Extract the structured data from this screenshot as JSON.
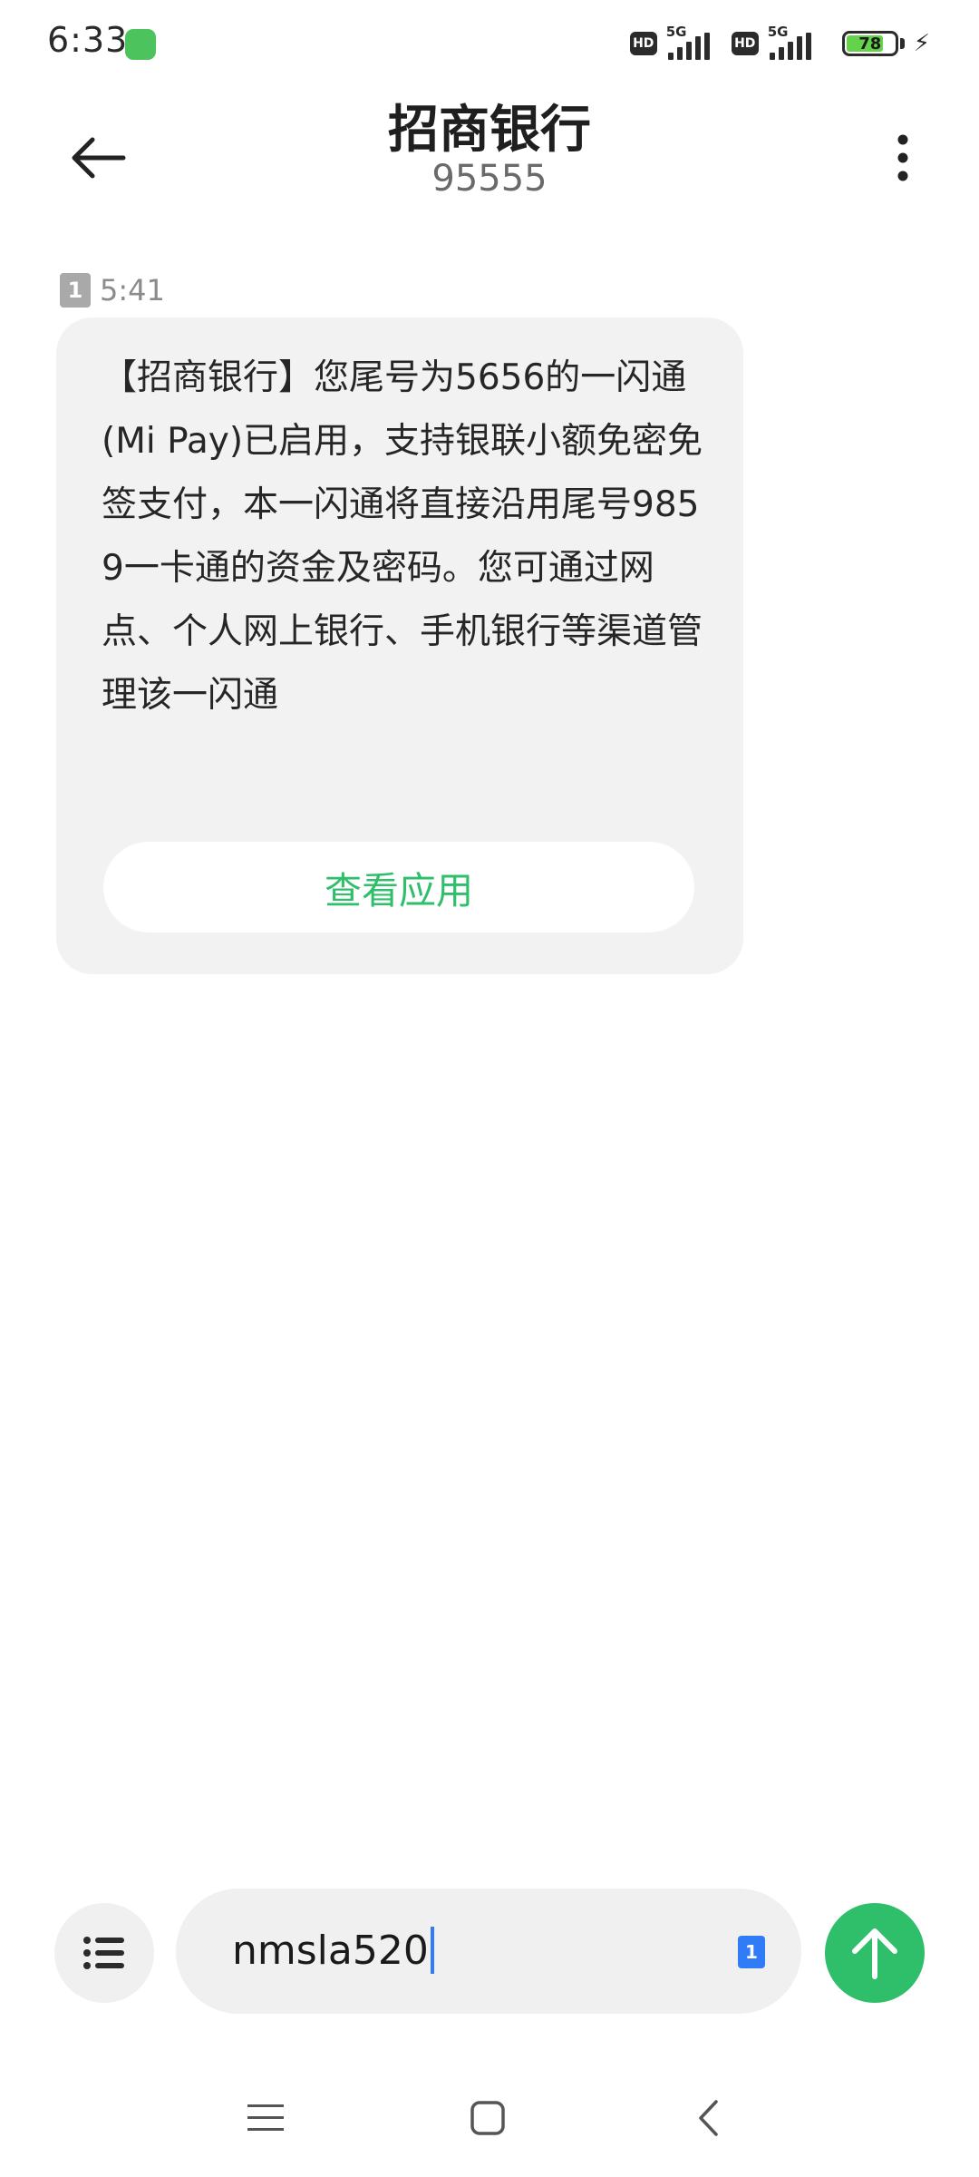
{
  "status_bar": {
    "time": "6:33",
    "hd_1": "HD",
    "network_1": "5G",
    "hd_2": "HD",
    "network_2": "5G",
    "battery_level": "78",
    "battery_color": "#64d24a"
  },
  "header": {
    "title": "招商银行",
    "subtitle": "95555"
  },
  "message": {
    "sim_slot": "1",
    "time": "5:41",
    "text": "【招商银行】您尾号为5656的一闪通(Mi Pay)已启用，支持银联小额免密免签支付，本一闪通将直接沿用尾号9859一卡通的资金及密码。您可通过网点、个人网上银行、手机银行等渠道管理该一闪通",
    "action_label": "查看应用"
  },
  "composer": {
    "input_value": "nmsla520",
    "sim_slot": "1"
  },
  "colors": {
    "accent_green": "#2fbf6a",
    "caret_blue": "#2f7cf6",
    "bubble_bg": "#f2f2f2"
  },
  "icons": {
    "back": "arrow-left-icon",
    "more": "more-vertical-icon",
    "menu": "list-icon",
    "send": "arrow-up-icon",
    "nav_recents": "menu-lines-icon",
    "nav_home": "square-icon",
    "nav_back": "chevron-left-icon"
  }
}
